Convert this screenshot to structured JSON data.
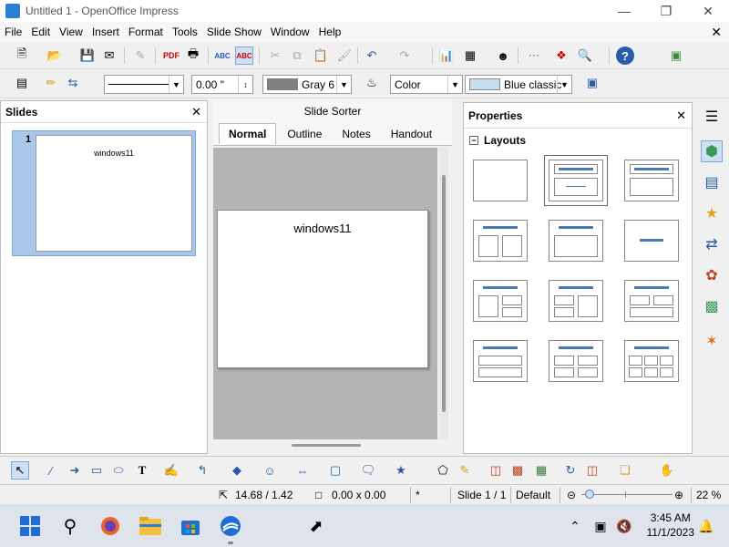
{
  "window": {
    "title": "Untitled 1 - OpenOffice Impress"
  },
  "menu": [
    "File",
    "Edit",
    "View",
    "Insert",
    "Format",
    "Tools",
    "Slide Show",
    "Window",
    "Help"
  ],
  "line_style": {
    "width_value": "0.00 \"",
    "area_color": "Gray 6",
    "area_style": "Color",
    "area_fill": "Blue classic"
  },
  "slides_panel": {
    "title": "Slides",
    "slide_number": "1",
    "slide_title": "windows11"
  },
  "center": {
    "top_label": "Slide Sorter",
    "tabs": [
      "Normal",
      "Outline",
      "Notes",
      "Handout"
    ],
    "slide_title": "windows11"
  },
  "properties": {
    "title": "Properties",
    "section": "Layouts"
  },
  "status": {
    "position": "14.68 / 1.42",
    "size": "0.00 x 0.00",
    "modified": "*",
    "slide": "Slide 1 / 1",
    "master": "Default",
    "zoom": "22 %"
  },
  "taskbar": {
    "time": "3:45 AM",
    "date": "11/1/2023"
  },
  "colors": {
    "accent": "#4a7ab5",
    "area_gray": "#808080",
    "blue_classic": "#c8dff0"
  }
}
